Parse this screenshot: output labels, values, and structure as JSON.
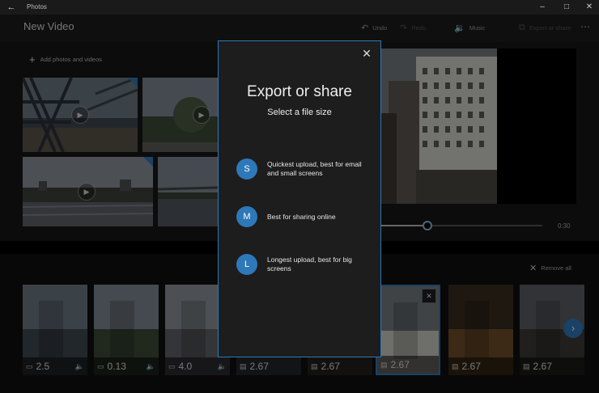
{
  "window": {
    "app_title": "Photos",
    "back_icon": "back-arrow-icon",
    "minimize_icon": "minimize-icon",
    "maximize_icon": "maximize-icon",
    "close_icon": "close-icon"
  },
  "header": {
    "title": "New Video",
    "undo_label": "Undo",
    "redo_label": "Redo",
    "music_label": "Music",
    "export_label": "Export or share",
    "more_icon": "more-icon"
  },
  "library": {
    "add_label": "Add photos and videos"
  },
  "preview": {
    "duration": "0:30",
    "progress": 0.29
  },
  "storyboard": {
    "remove_all_label": "Remove all",
    "cards": [
      {
        "duration": "2.5",
        "kind": "video",
        "has_audio": true
      },
      {
        "duration": "0.13",
        "kind": "video",
        "has_audio": true
      },
      {
        "duration": "4.0",
        "kind": "video",
        "has_audio": true
      },
      {
        "duration": "2.67",
        "kind": "photo",
        "has_audio": false
      },
      {
        "duration": "2.67",
        "kind": "photo",
        "has_audio": false
      },
      {
        "duration": "2.67",
        "kind": "photo",
        "has_audio": false,
        "selected": true
      },
      {
        "duration": "2.67",
        "kind": "photo",
        "has_audio": false
      },
      {
        "duration": "2.67",
        "kind": "photo",
        "has_audio": false
      }
    ]
  },
  "dialog": {
    "title": "Export or share",
    "subtitle": "Select a file size",
    "options": [
      {
        "badge": "S",
        "text": "Quickest upload, best for email and small screens"
      },
      {
        "badge": "M",
        "text": "Best for sharing online"
      },
      {
        "badge": "L",
        "text": "Longest upload, best for big screens"
      }
    ]
  },
  "colors": {
    "accent": "#2e78b8"
  }
}
